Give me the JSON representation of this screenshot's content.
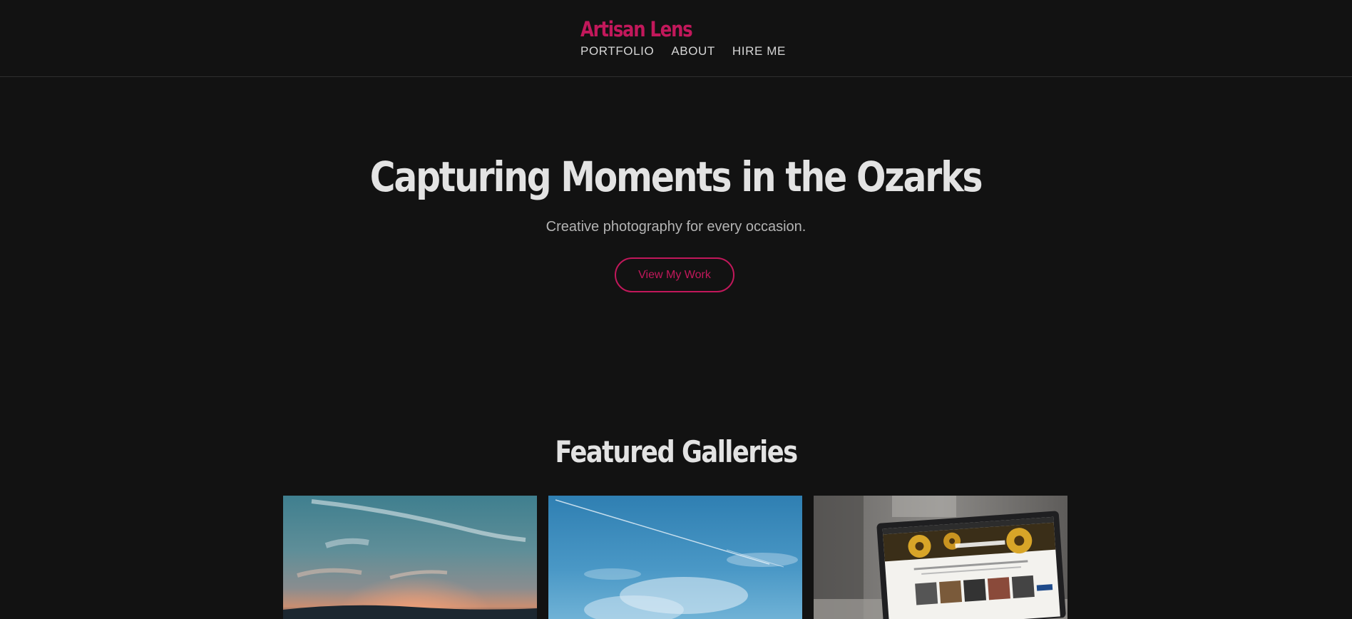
{
  "theme": {
    "accent": "#c2185b",
    "background": "#121212"
  },
  "header": {
    "brand": "Artisan Lens",
    "nav": [
      "PORTFOLIO",
      "ABOUT",
      "HIRE ME"
    ]
  },
  "hero": {
    "title": "Capturing Moments in the Ozarks",
    "subtitle": "Creative photography for every occasion.",
    "cta_label": "View My Work"
  },
  "featured": {
    "title": "Featured Galleries",
    "photos": [
      {
        "subject": "sunset-sky-photo"
      },
      {
        "subject": "blue-sky-photo"
      },
      {
        "subject": "laptop-website-photo"
      }
    ]
  }
}
